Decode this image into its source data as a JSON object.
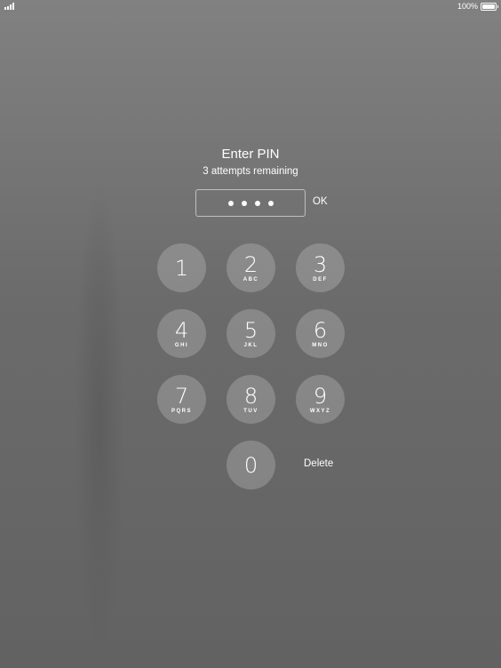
{
  "status_bar": {
    "battery_text": "100%",
    "battery_level": 1.0
  },
  "pin_screen": {
    "title": "Enter PIN",
    "subtitle": "3 attempts remaining",
    "entered_digits": 4,
    "ok_label": "OK",
    "delete_label": "Delete"
  },
  "keypad": {
    "keys": [
      {
        "digit": "1",
        "letters": ""
      },
      {
        "digit": "2",
        "letters": "ABC"
      },
      {
        "digit": "3",
        "letters": "DEF"
      },
      {
        "digit": "4",
        "letters": "GHI"
      },
      {
        "digit": "5",
        "letters": "JKL"
      },
      {
        "digit": "6",
        "letters": "MNO"
      },
      {
        "digit": "7",
        "letters": "PQRS"
      },
      {
        "digit": "8",
        "letters": "TUV"
      },
      {
        "digit": "9",
        "letters": "WXYZ"
      },
      {
        "digit": "0",
        "letters": ""
      }
    ]
  }
}
